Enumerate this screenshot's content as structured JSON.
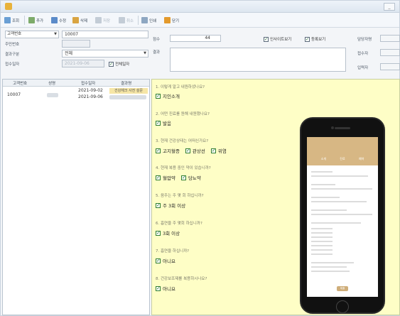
{
  "window": {
    "title": "",
    "minimize_label": "_"
  },
  "toolbar": {
    "buttons": [
      {
        "label": "조회"
      },
      {
        "label": "추가"
      },
      {
        "label": "수정"
      },
      {
        "label": "삭제"
      },
      {
        "label": "저장"
      },
      {
        "label": "취소"
      },
      {
        "label": "인쇄"
      },
      {
        "label": "닫기"
      }
    ]
  },
  "filters": {
    "customer_select": "고객번호",
    "customer_value": "10007",
    "row2_label": "주민번호",
    "row2_value": "",
    "status_label": "결과구분",
    "status_value": "전체",
    "date_label": "접수일자",
    "date_value": "2021-09-06",
    "all_dates_label": "전체일자"
  },
  "memo": {
    "field1_label": "점수",
    "field1_value": "44",
    "field2_label": "결과",
    "check1_label": "인사이트보기",
    "check2_label": "등록보기",
    "right1_label": "담당자명",
    "right2_label": "접수자",
    "right3_label": "입력자"
  },
  "grid": {
    "headers": [
      "고객번호",
      "성명",
      "접수일자",
      "결과명"
    ],
    "rows": [
      {
        "id": "10007",
        "date1": "2021-09-02",
        "date2": "2021-09-06",
        "tag": "건강체크 사전 설문"
      }
    ]
  },
  "survey": {
    "questions": [
      {
        "q": "1. 이렇게 알고 내원하셨나요?",
        "answers": [
          "지인소개"
        ]
      },
      {
        "q": "2. 어떤 진료를 원해 내원했나요?",
        "answers": [
          "발음"
        ]
      },
      {
        "q": "3. 현재 건강상태는 어떠신가요?",
        "answers": [
          "고지혈증",
          "관상선",
          "위염"
        ]
      },
      {
        "q": "4. 현재 복용 중인 약이 있습니까?",
        "answers": [
          "혈압약",
          "당뇨약"
        ]
      },
      {
        "q": "5. 음주는 주 몇 회 하십니까?",
        "answers": [
          "주 3회 이상"
        ]
      },
      {
        "q": "6. 흡연을 주 몇회 하십니까?",
        "answers": [
          "3회 이상"
        ]
      },
      {
        "q": "7. 흡연을 하십니까?",
        "answers": [
          "아니요"
        ]
      },
      {
        "q": "8. 건강보조제를 복용하시나요?",
        "answers": [
          "아니요"
        ]
      }
    ]
  },
  "phone": {
    "banner_tabs": [
      "소개",
      "진료",
      "예약"
    ],
    "button_label": "제출"
  },
  "colors": {
    "panel_bg": "#fefec6",
    "tag_bg": "#f6e6a6",
    "check_green": "#2e7d32",
    "banner": "#d7b784"
  }
}
